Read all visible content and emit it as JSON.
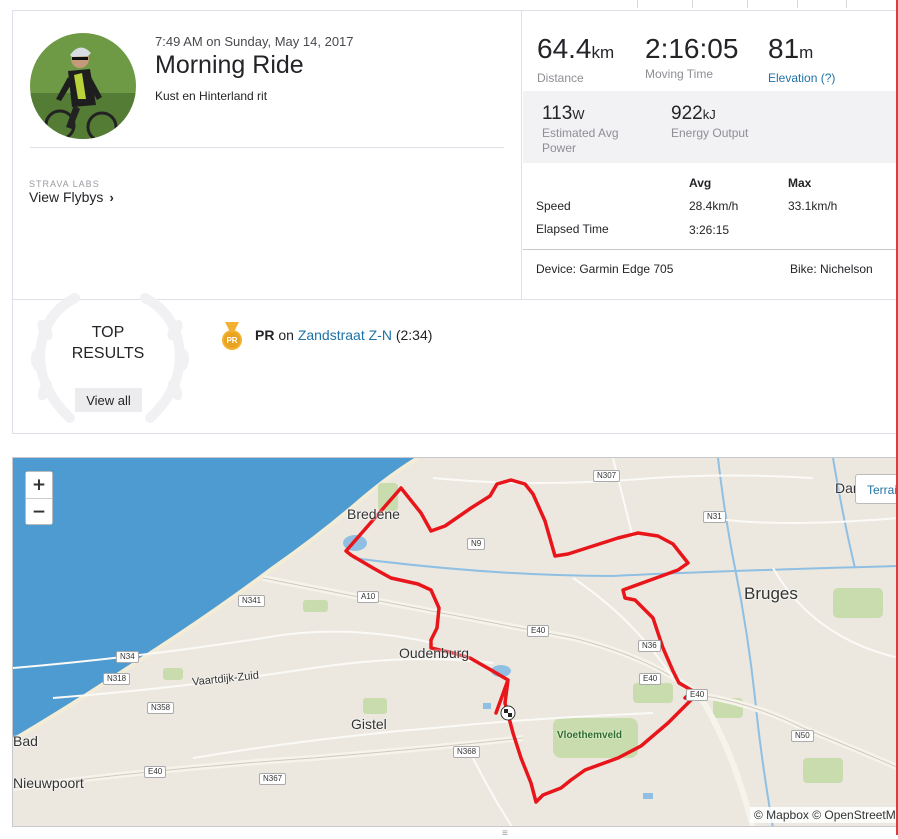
{
  "activity": {
    "date": "7:49 AM on Sunday, May 14, 2017",
    "title": "Morning Ride",
    "description": "Kust en Hinterland rit"
  },
  "labs": {
    "eyebrow": "STRAVA LABS",
    "link": "View Flybys",
    "chevron": "›"
  },
  "stats": {
    "distance": {
      "value": "64.4",
      "unit": "km",
      "label": "Distance"
    },
    "moving_time": {
      "value": "2:16:05",
      "label": "Moving Time"
    },
    "elevation": {
      "value": "81",
      "unit": "m",
      "label": "Elevation (?)"
    },
    "power": {
      "value": "113",
      "unit": "W",
      "label": "Estimated Avg Power"
    },
    "energy": {
      "value": "922",
      "unit": "kJ",
      "label": "Energy Output"
    }
  },
  "table": {
    "col_avg": "Avg",
    "col_max": "Max",
    "rows": [
      {
        "label": "Speed",
        "avg": "28.4km/h",
        "max": "33.1km/h"
      },
      {
        "label": "Elapsed Time",
        "avg": "3:26:15",
        "max": ""
      }
    ],
    "device": "Device: Garmin Edge 705",
    "bike": "Bike: Nichelson"
  },
  "results": {
    "title_line1": "TOP",
    "title_line2": "RESULTS",
    "view_all": "View all",
    "pr_label": "PR",
    "pr_on": "on",
    "segment": "Zandstraat Z-N",
    "time": "(2:34)",
    "medal_text": "PR"
  },
  "map": {
    "zoom_in": "+",
    "zoom_out": "−",
    "terrain": "Terrain",
    "attribution": "© Mapbox © OpenStreetMap",
    "places": {
      "bredene": "Bredene",
      "oudenburg": "Oudenburg",
      "gistel": "Gistel",
      "bruges": "Bruges",
      "vloethemveld": "Vloethemveld",
      "vaartdijk": "Vaartdijk-Zuid",
      "nieuwpoort": "Nieuwpoort",
      "bad": "Bad",
      "dam": "Dam"
    },
    "roads": {
      "n307": "N307",
      "n31": "N31",
      "n9": "N9",
      "a10": "A10",
      "n341": "N341",
      "e40a": "E40",
      "n34": "N34",
      "n318": "N318",
      "n358": "N358",
      "n36": "N36",
      "e40b": "E40",
      "e40c": "E40",
      "n50": "N50",
      "n368": "N368",
      "e40d": "E40",
      "n367": "N367"
    },
    "colors": {
      "route": "#e8161b",
      "sea": "#4d9bd1",
      "land": "#ece8e0"
    }
  },
  "accent_color": "#1f72a4"
}
